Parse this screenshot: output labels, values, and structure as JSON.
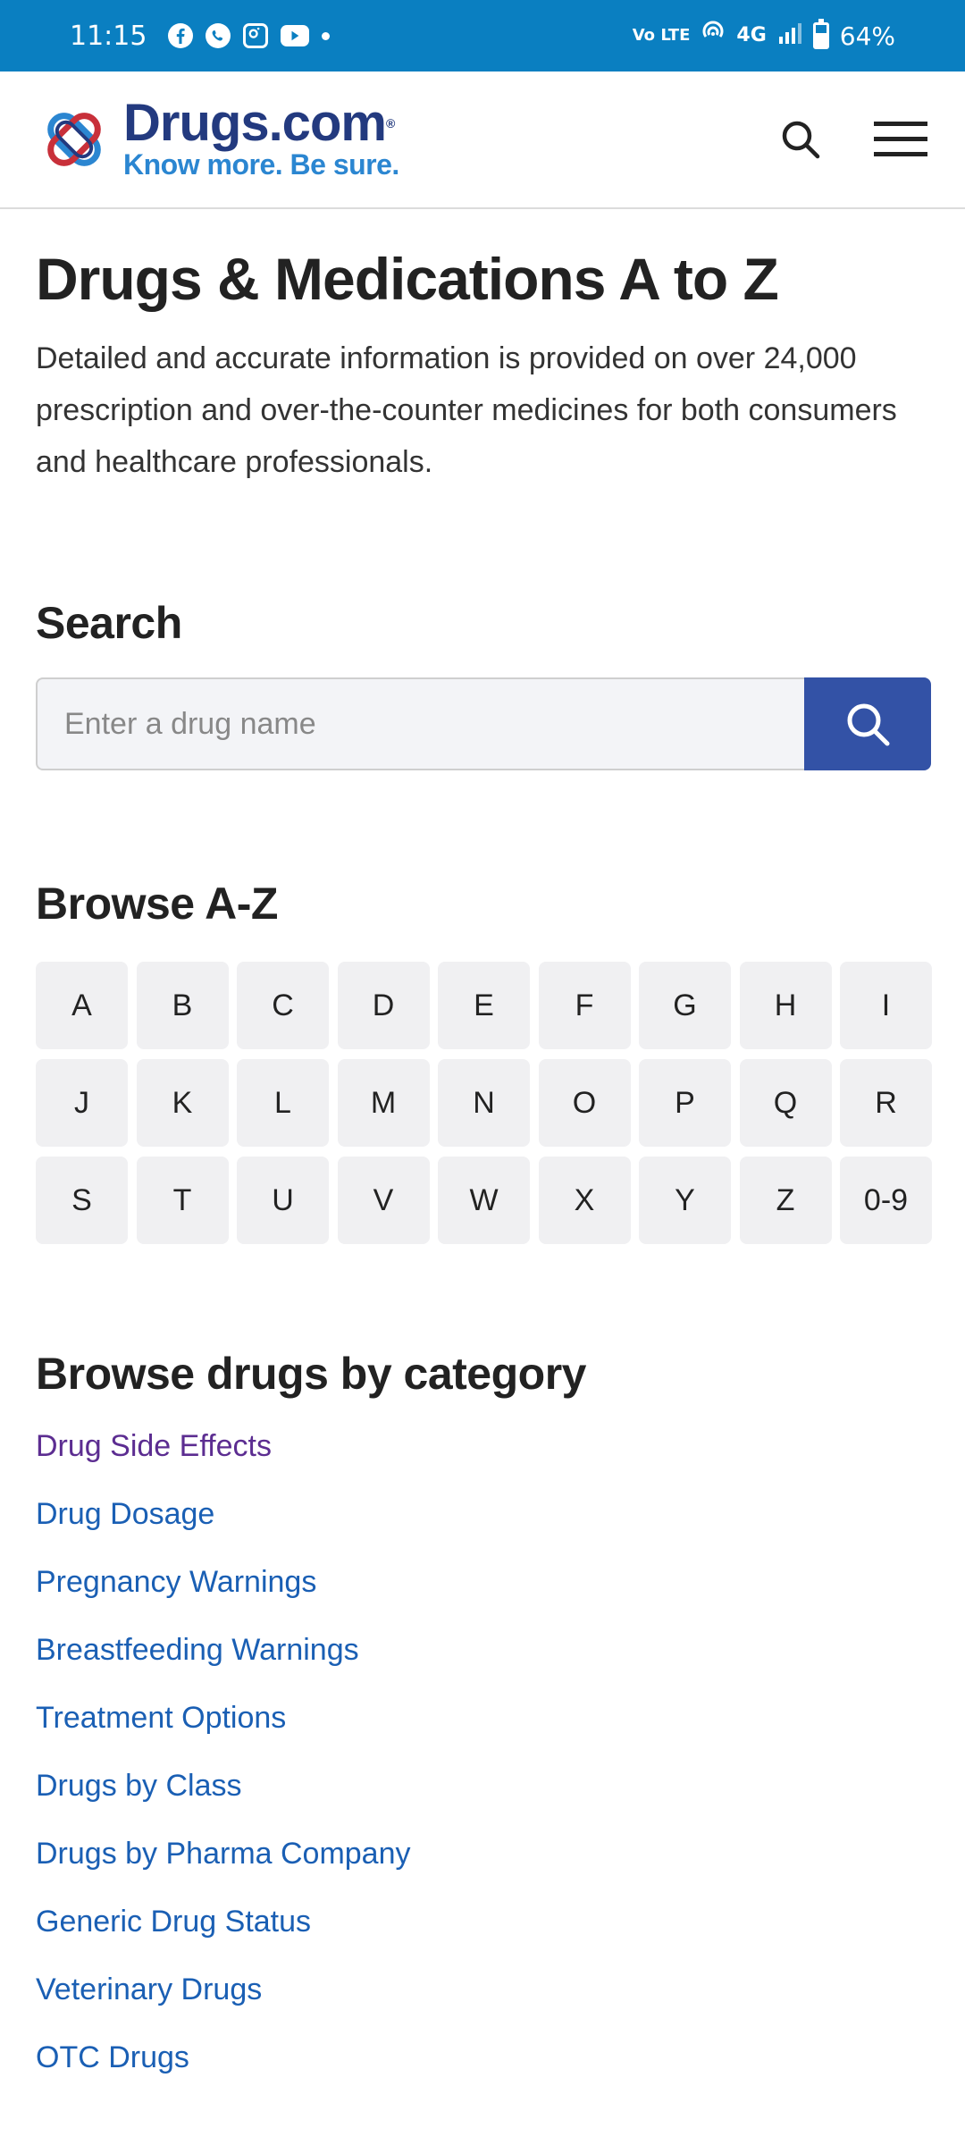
{
  "status_bar": {
    "time": "11:15",
    "icons": [
      "facebook-icon",
      "whatsapp-icon",
      "instagram-icon",
      "youtube-icon"
    ],
    "network_label": "Vo LTE",
    "network_type": "4G",
    "battery": "64%"
  },
  "header": {
    "brand": "Drugs.com",
    "registered_mark": "®",
    "tagline": "Know more. Be sure."
  },
  "main": {
    "title": "Drugs & Medications A to Z",
    "intro": "Detailed and accurate information is provided on over 24,000 prescription and over-the-counter medicines for both consumers and healthcare professionals.",
    "search": {
      "heading": "Search",
      "placeholder": "Enter a drug name",
      "value": ""
    },
    "browse": {
      "heading": "Browse A-Z",
      "letters": [
        "A",
        "B",
        "C",
        "D",
        "E",
        "F",
        "G",
        "H",
        "I",
        "J",
        "K",
        "L",
        "M",
        "N",
        "O",
        "P",
        "Q",
        "R",
        "S",
        "T",
        "U",
        "V",
        "W",
        "X",
        "Y",
        "Z",
        "0-9"
      ]
    },
    "categories": {
      "heading": "Browse drugs by category",
      "items": [
        {
          "label": "Drug Side Effects",
          "visited": true
        },
        {
          "label": "Drug Dosage",
          "visited": false
        },
        {
          "label": "Pregnancy Warnings",
          "visited": false
        },
        {
          "label": "Breastfeeding Warnings",
          "visited": false
        },
        {
          "label": "Treatment Options",
          "visited": false
        },
        {
          "label": "Drugs by Class",
          "visited": false
        },
        {
          "label": "Drugs by Pharma Company",
          "visited": false
        },
        {
          "label": "Generic Drug Status",
          "visited": false
        },
        {
          "label": "Veterinary Drugs",
          "visited": false
        },
        {
          "label": "OTC Drugs",
          "visited": false
        }
      ]
    }
  },
  "colors": {
    "status_bar": "#0a7fc1",
    "brand": "#233a7f",
    "tagline": "#2b86d1",
    "search_button": "#3352a6",
    "link": "#1a5fb4",
    "link_visited": "#5c2d91"
  }
}
